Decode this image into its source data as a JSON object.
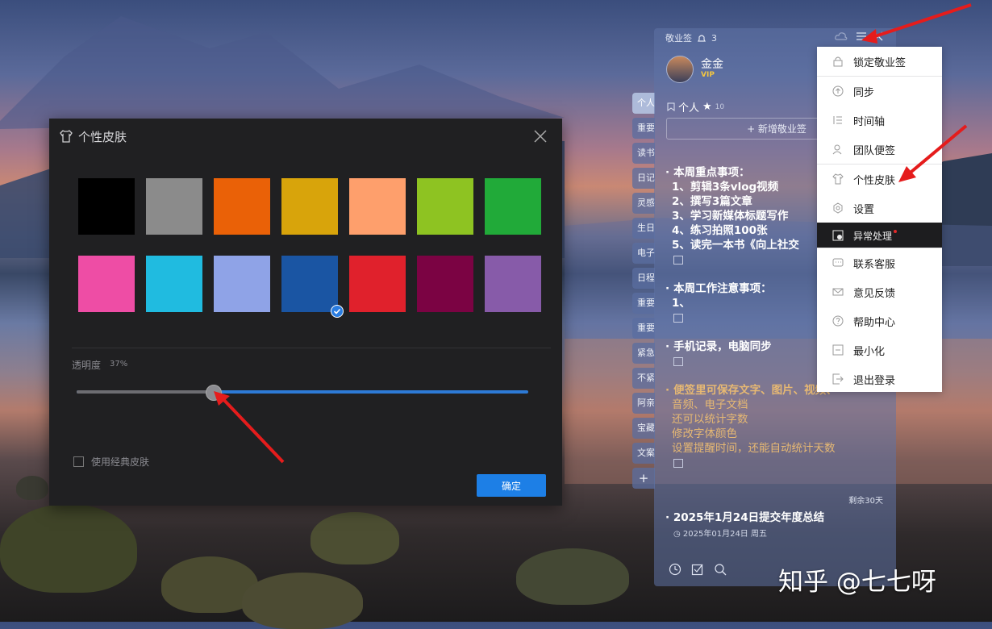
{
  "dialog": {
    "title": "个性皮肤",
    "swatches": [
      {
        "color": "#000000",
        "selected": false
      },
      {
        "color": "#8b8b8b",
        "selected": false
      },
      {
        "color": "#ea6107",
        "selected": false
      },
      {
        "color": "#d8a40b",
        "selected": false
      },
      {
        "color": "#fe9f6c",
        "selected": false
      },
      {
        "color": "#8ec322",
        "selected": false
      },
      {
        "color": "#21aa39",
        "selected": false
      },
      {
        "color": "#ee4da5",
        "selected": false
      },
      {
        "color": "#20bbe0",
        "selected": false
      },
      {
        "color": "#8fa3e7",
        "selected": false
      },
      {
        "color": "#1a55a3",
        "selected": true
      },
      {
        "color": "#e0212c",
        "selected": false
      },
      {
        "color": "#7b0343",
        "selected": false
      },
      {
        "color": "#875ba9",
        "selected": false
      }
    ],
    "opacity_label": "透明度",
    "opacity_value": "37%",
    "classic_skin_label": "使用经典皮肤",
    "classic_skin_checked": false,
    "confirm_label": "确定"
  },
  "panel": {
    "app_name": "敬业签",
    "notification_count": "3",
    "user_name": "金金",
    "vip_label": "VIP",
    "folder_name": "个人",
    "folder_count": "10",
    "add_note_label": "+ 新增敬业签",
    "notes": [
      {
        "title": "本周重点事项：",
        "lines": [
          "1、剪辑3条vlog视频",
          "2、撰写3篇文章",
          "3、学习新媒体标题写作",
          "4、练习拍照100张",
          "5、读完一本书《向上社交"
        ]
      },
      {
        "title": "本周工作注意事项：",
        "lines": [
          "1、"
        ]
      },
      {
        "title": "手机记录，电脑同步",
        "lines": []
      },
      {
        "title": "便签里可保存文字、图片、视频、",
        "lines": [
          "音频、电子文档",
          "还可以统计字数",
          "修改字体颜色",
          "设置提醒时间，还能自动统计天数"
        ]
      }
    ],
    "remaining_label": "剩余30天",
    "dated_note_title": "2025年1月24日提交年度总结",
    "dated_note_date": "2025年01月24日  周五"
  },
  "side_tabs": [
    "个人★",
    "重要",
    "读书",
    "日记",
    "灵感",
    "生日",
    "电子",
    "日程",
    "重要",
    "重要",
    "紧急",
    "不紧",
    "阿亲",
    "宝藏",
    "文案",
    "+"
  ],
  "menu": {
    "items": [
      {
        "label": "锁定敬业签",
        "icon": "lock-icon"
      },
      {
        "label": "同步",
        "icon": "sync-icon"
      },
      {
        "label": "时间轴",
        "icon": "timeline-icon"
      },
      {
        "label": "团队便签",
        "icon": "team-icon"
      },
      {
        "label": "个性皮肤",
        "icon": "shirt-icon"
      },
      {
        "label": "设置",
        "icon": "settings-icon"
      },
      {
        "label": "异常处理",
        "icon": "exception-icon"
      },
      {
        "label": "联系客服",
        "icon": "chat-icon"
      },
      {
        "label": "意见反馈",
        "icon": "mail-icon"
      },
      {
        "label": "帮助中心",
        "icon": "help-icon"
      },
      {
        "label": "最小化",
        "icon": "minimize-icon"
      },
      {
        "label": "退出登录",
        "icon": "logout-icon"
      }
    ]
  },
  "watermark": "知乎 @七七呀"
}
